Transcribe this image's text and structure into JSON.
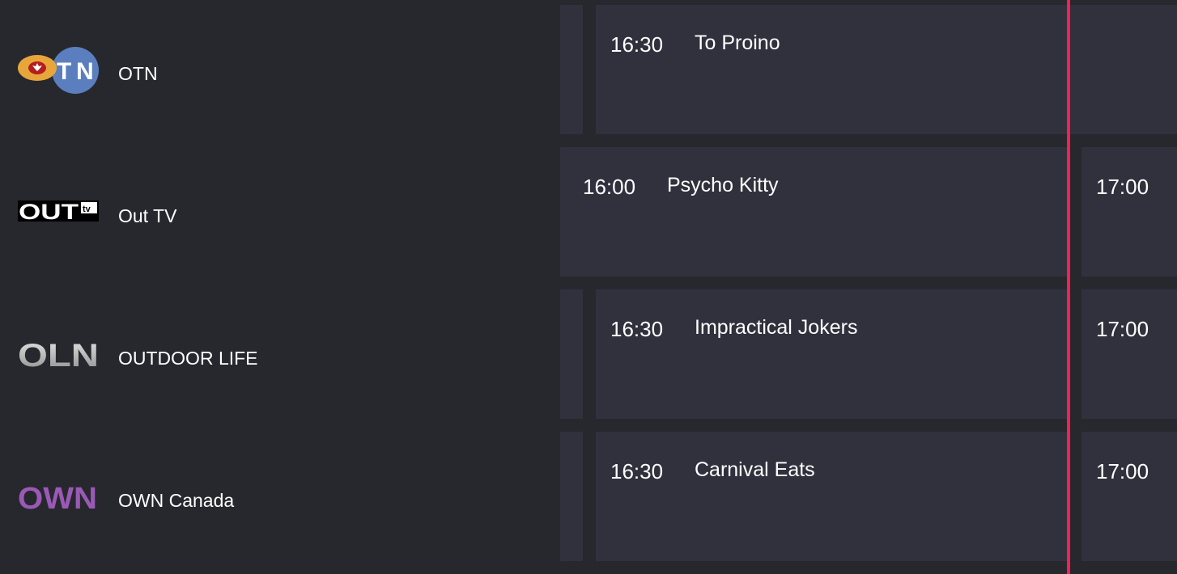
{
  "channels": [
    {
      "name": "OTN",
      "logo_icon": "otn-logo-icon",
      "programs": [
        {
          "time": "",
          "title": ""
        },
        {
          "time": "16:30",
          "title": "To Proino"
        }
      ]
    },
    {
      "name": "Out TV",
      "logo_icon": "outtv-logo-icon",
      "programs": [
        {
          "time": "16:00",
          "title": "Psycho Kitty"
        },
        {
          "time": "17:00",
          "title": ""
        }
      ]
    },
    {
      "name": "OUTDOOR LIFE",
      "logo_icon": "oln-logo-icon",
      "programs": [
        {
          "time": "",
          "title": ""
        },
        {
          "time": "16:30",
          "title": "Impractical Jokers"
        },
        {
          "time": "17:00",
          "title": ""
        }
      ]
    },
    {
      "name": "OWN Canada",
      "logo_icon": "own-logo-icon",
      "programs": [
        {
          "time": "",
          "title": ""
        },
        {
          "time": "16:30",
          "title": "Carnival Eats"
        },
        {
          "time": "17:00",
          "title": ""
        }
      ]
    }
  ],
  "colors": {
    "background": "#27282e",
    "cell": "#30313d",
    "now_indicator": "#ff1e55",
    "own_purple": "#9b59b6"
  }
}
